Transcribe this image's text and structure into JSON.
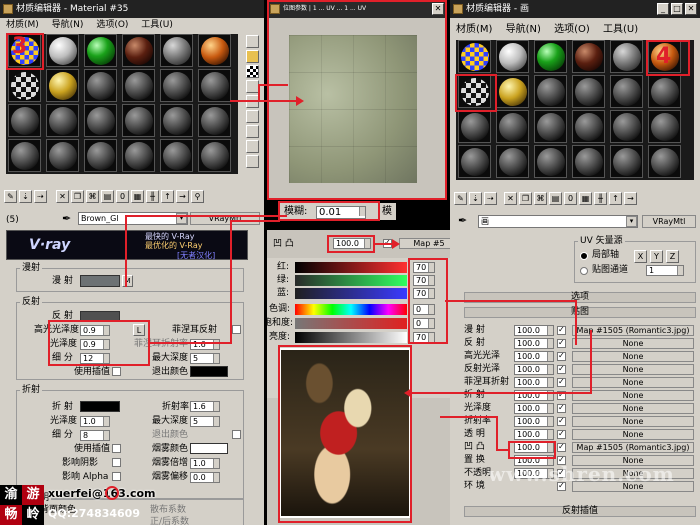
{
  "left_editor": {
    "title": "材质编辑器 - Material #35",
    "menu": [
      "材质(M)",
      "导航(N)",
      "选项(O)",
      "工具(U)"
    ],
    "badge": "3",
    "material_name": "Brown_Gl",
    "material_type": "VRayMtl",
    "slot_label": "(5)",
    "banner_logo": "V·ray",
    "banner_line1": "最快的 V-Ray",
    "banner_line2": "最优化的 V-Ray",
    "banner_line3": "[无者汉化]",
    "diffuse_section": "漫射",
    "diffuse_label": "漫 射",
    "diffuse_map_btn": "M",
    "reflect_section": "反射",
    "reflect_label": "反 射",
    "hilight_gloss_label": "高光光泽度",
    "hilight_gloss_value": "0.9",
    "lock_btn": "L",
    "fresnel_label": "菲涅耳反射",
    "gloss_label": "光泽度",
    "gloss_value": "0.9",
    "fresnel_ior_label": "菲涅耳折射率",
    "fresnel_ior_value": "1.6",
    "subdiv_label": "细 分",
    "subdiv_value": "12",
    "max_depth_label": "最大深度",
    "max_depth_value": "5",
    "use_interp_label": "使用插值",
    "exit_color_label": "退出颜色",
    "refract_section": "折射",
    "refract_label": "折 射",
    "ior_label": "折射率",
    "ior_value": "1.6",
    "refract_gloss_label": "光泽度",
    "refract_gloss_value": "1.0",
    "refract_maxdepth_label": "最大深度",
    "refract_maxdepth_value": "5",
    "refract_subdiv_label": "细 分",
    "refract_subdiv_value": "8",
    "refract_exit_label": "退出颜色",
    "refract_interp_label": "使用插值",
    "fog_color_label": "烟雾颜色",
    "shadow_label": "影响阴影",
    "fog_mult_label": "烟雾倍增",
    "fog_mult_value": "1.0",
    "alpha_label": "影响 Alpha",
    "fog_bias_label": "烟雾偏移",
    "fog_bias_value": "0.0",
    "translucent_label": "半透明",
    "backside_label": "背面颜色",
    "scatter_label": "散布系数",
    "fwd_back_label": "正/后系数"
  },
  "texture_window": {
    "title": "位图参数 | 1 ... UV ... 1 ... UV",
    "blur_label": "模糊:",
    "blur_value": "0.01",
    "blur_suffix": "模"
  },
  "bump_panel": {
    "bump_label": "凹 凸",
    "bump_value": "100.0",
    "map_btn": "Map #5",
    "red_label": "红:",
    "green_label": "绿:",
    "blue_label": "蓝:",
    "hue_label": "色调:",
    "sat_label": "饱和度:",
    "val_label": "亮度:",
    "red_value": "70",
    "green_value": "70",
    "blue_value": "70",
    "hue_value": "0",
    "sat_value": "0",
    "val_value": "70"
  },
  "right_editor": {
    "title": "材质编辑器 - 画",
    "menu": [
      "材质(M)",
      "导航(N)",
      "选项(O)",
      "工具(U)"
    ],
    "badge": "4",
    "material_name": "画",
    "material_type": "VRayMtl",
    "uv_title": "UV 矢量源",
    "uv_local": "局部轴",
    "uv_channel": "贴图通道",
    "uv_x": "X",
    "uv_y": "Y",
    "uv_z": "Z",
    "uv_channel_value": "1",
    "options_rollout": "选项",
    "maps_rollout": "贴图",
    "reflect_interp_rollout": "反射插值",
    "map_rows": [
      {
        "label": "漫 射",
        "value": "100.0",
        "map": "Map #1505 (Romantic3.jpg)"
      },
      {
        "label": "反 射",
        "value": "100.0",
        "map": "None"
      },
      {
        "label": "高光光泽",
        "value": "100.0",
        "map": "None"
      },
      {
        "label": "反射光泽",
        "value": "100.0",
        "map": "None"
      },
      {
        "label": "菲涅耳折射",
        "value": "100.0",
        "map": "None"
      },
      {
        "label": "折 射",
        "value": "100.0",
        "map": "None"
      },
      {
        "label": "光泽度",
        "value": "100.0",
        "map": "None"
      },
      {
        "label": "折射率",
        "value": "100.0",
        "map": "None"
      },
      {
        "label": "透 明",
        "value": "100.0",
        "map": "None"
      },
      {
        "label": "凹 凸",
        "value": "100.0",
        "map": "Map #1505 (Romantic3.jpg)"
      },
      {
        "label": "置 换",
        "value": "100.0",
        "map": "None"
      },
      {
        "label": "不透明",
        "value": "100.0",
        "map": "None"
      },
      {
        "label": "环 境",
        "value": "",
        "map": "None"
      }
    ]
  },
  "watermark": {
    "text": "www.shren.com",
    "footer_email": "xuerfei@163.com",
    "footer_qq": "QQ:274834609",
    "footer_logo_top": "渝",
    "footer_logo_top2": "游",
    "footer_logo_bottom": "畅",
    "footer_logo_bottom2": "岭"
  },
  "colors": {
    "accent_red": "#e0202a",
    "window_bg": "#d4d0c8",
    "titlebar": "#222222"
  }
}
